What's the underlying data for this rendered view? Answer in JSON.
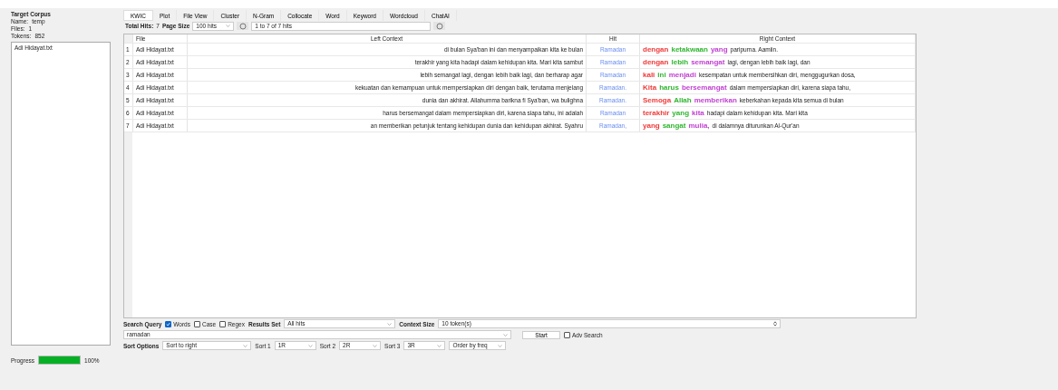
{
  "corpus": {
    "title": "Target Corpus",
    "fields": [
      {
        "label": "Name:",
        "value": "temp"
      },
      {
        "label": "Files:",
        "value": "1"
      },
      {
        "label": "Tokens:",
        "value": "852"
      }
    ],
    "files": [
      "Adi Hidayat.txt"
    ]
  },
  "progress": {
    "label": "Progress",
    "level": 1,
    "reading": "100%"
  },
  "tabs": [
    {
      "label": "KWIC",
      "selected": true
    },
    {
      "label": "Plot",
      "selected": false
    },
    {
      "label": "File View",
      "selected": false
    },
    {
      "label": "Cluster",
      "selected": false
    },
    {
      "label": "N-Gram",
      "selected": false
    },
    {
      "label": "Collocate",
      "selected": false
    },
    {
      "label": "Word",
      "selected": false
    },
    {
      "label": "Keyword",
      "selected": false
    },
    {
      "label": "Wordcloud",
      "selected": false
    },
    {
      "label": "ChatAI",
      "selected": false
    }
  ],
  "toolbar": {
    "total_label": "Total Hits:",
    "total": "7",
    "page_size_label": "Page Size",
    "page_size": "100 hits",
    "range": "1 to 7 of 7 hits"
  },
  "table": {
    "columns": [
      "File",
      "Left Context",
      "Hit",
      "Right Context"
    ],
    "rows": [
      {
        "num": "1",
        "file": "Adi Hidayat.txt",
        "left": "di bulan Sya'ban ini dan menyampaikan kita ke bulan",
        "hit": "Ramadan",
        "right": [
          {
            "text": "dengan",
            "color": "#f03838"
          },
          {
            "text": "ketakwaan",
            "color": "#2fb52f"
          },
          {
            "text": "yang",
            "color": "#c040d0"
          }
        ],
        "rest": "paripurna. Aamiin."
      },
      {
        "num": "2",
        "file": "Adi Hidayat.txt",
        "left": "terakhir yang kita hadapi dalam kehidupan kita. Mari kita sambut",
        "hit": "Ramadan",
        "right": [
          {
            "text": "dengan",
            "color": "#f03838"
          },
          {
            "text": "lebih",
            "color": "#2fb52f"
          },
          {
            "text": "semangat",
            "color": "#c040d0"
          }
        ],
        "rest": "lagi, dengan lebih baik lagi, dan"
      },
      {
        "num": "3",
        "file": "Adi Hidayat.txt",
        "left": "lebih semangat lagi, dengan lebih baik lagi, dan berharap agar",
        "hit": "Ramadan",
        "right": [
          {
            "text": "kali",
            "color": "#f03838"
          },
          {
            "text": "ini",
            "color": "#2fb52f"
          },
          {
            "text": "menjadi",
            "color": "#c040d0"
          }
        ],
        "rest": "kesempatan untuk membersihkan diri, menggugurkan dosa,"
      },
      {
        "num": "4",
        "file": "Adi Hidayat.txt",
        "left": "kekuatan dan kemampuan untuk mempersiapkan diri dengan baik, terutama menjelang",
        "hit": "Ramadan.",
        "right": [
          {
            "text": "Kita",
            "color": "#f03838"
          },
          {
            "text": "harus",
            "color": "#2fb52f"
          },
          {
            "text": "bersemangat",
            "color": "#c040d0"
          }
        ],
        "rest": "dalam mempersiapkan diri, karena siapa tahu,"
      },
      {
        "num": "5",
        "file": "Adi Hidayat.txt",
        "left": "dunia dan akhirat. Allahumma barikna fi Sya'ban, wa bulighna",
        "hit": "Ramadan.",
        "right": [
          {
            "text": "Semoga",
            "color": "#f03838"
          },
          {
            "text": "Allah",
            "color": "#2fb52f"
          },
          {
            "text": "memberikan",
            "color": "#c040d0"
          }
        ],
        "rest": "keberkahan kepada kita semua di bulan"
      },
      {
        "num": "6",
        "file": "Adi Hidayat.txt",
        "left": "harus bersemangat dalam mempersiapkan diri, karena siapa tahu, ini adalah",
        "hit": "Ramadan",
        "right": [
          {
            "text": "terakhir",
            "color": "#f03838"
          },
          {
            "text": "yang",
            "color": "#2fb52f"
          },
          {
            "text": "kita",
            "color": "#c040d0"
          }
        ],
        "rest": "hadapi dalam kehidupan kita. Mari kita"
      },
      {
        "num": "7",
        "file": "Adi Hidayat.txt",
        "left": "an memberikan petunjuk tentang kehidupan dunia dan kehidupan akhirat. Syahru",
        "hit": "Ramadan,",
        "right": [
          {
            "text": "yang",
            "color": "#f03838"
          },
          {
            "text": "sangat",
            "color": "#2fb52f"
          },
          {
            "text": "mulia,",
            "color": "#c040d0"
          }
        ],
        "rest": "di dalamnya diturunkan Al-Qur'an"
      }
    ]
  },
  "search": {
    "label": "Search Query",
    "options": [
      {
        "label": "Words",
        "checked": true
      },
      {
        "label": "Case",
        "checked": false
      },
      {
        "label": "Regex",
        "checked": false
      }
    ],
    "results_label": "Results Set",
    "results": "All hits",
    "context_label": "Context Size",
    "context": "10 token(s)",
    "query": "ramadan",
    "start": "Start",
    "adv": {
      "label": "Adv Search",
      "checked": false
    }
  },
  "sort": {
    "label": "Sort Options",
    "mode": "Sort to right",
    "sorts": [
      {
        "label": "Sort 1",
        "value": "1R"
      },
      {
        "label": "Sort 2",
        "value": "2R"
      },
      {
        "label": "Sort 3",
        "value": "3R"
      }
    ],
    "order": "Order by freq"
  }
}
